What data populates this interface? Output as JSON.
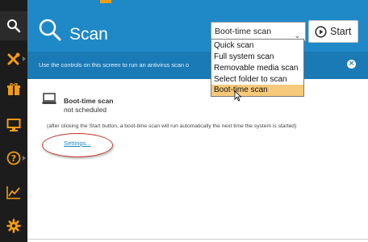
{
  "sidebar": {
    "items": [
      {
        "name": "search-icon",
        "active": true
      },
      {
        "name": "tools-icon",
        "active": false
      },
      {
        "name": "store-icon",
        "active": false
      },
      {
        "name": "monitor-icon",
        "active": false
      },
      {
        "name": "help-icon",
        "active": false
      },
      {
        "name": "stats-icon",
        "active": false
      },
      {
        "name": "settings-gear-icon",
        "active": false
      }
    ]
  },
  "header": {
    "title": "Scan",
    "select_value": "Boot-time scan",
    "start_label": "Start"
  },
  "info": {
    "text": "Use the controls on this screen to run an antivirus scan o"
  },
  "dropdown": {
    "options": [
      "Quick scan",
      "Full system scan",
      "Removable media scan",
      "Select folder to scan",
      "Boot-time scan"
    ],
    "selected": "Boot-time scan"
  },
  "boot_scan": {
    "title": "Boot-time scan",
    "status": "not scheduled",
    "note": "(after clicking the Start button, a boot-time scan will run automatically the next time the system is started)",
    "settings_link": "Settings..."
  },
  "colors": {
    "accent": "#1f89c8",
    "info_bar": "#1a7ab6",
    "sidebar": "#1c1c1c",
    "icon_orange": "#f39c12",
    "annotation": "#c0392b",
    "dropdown_highlight": "#f7c97a"
  }
}
